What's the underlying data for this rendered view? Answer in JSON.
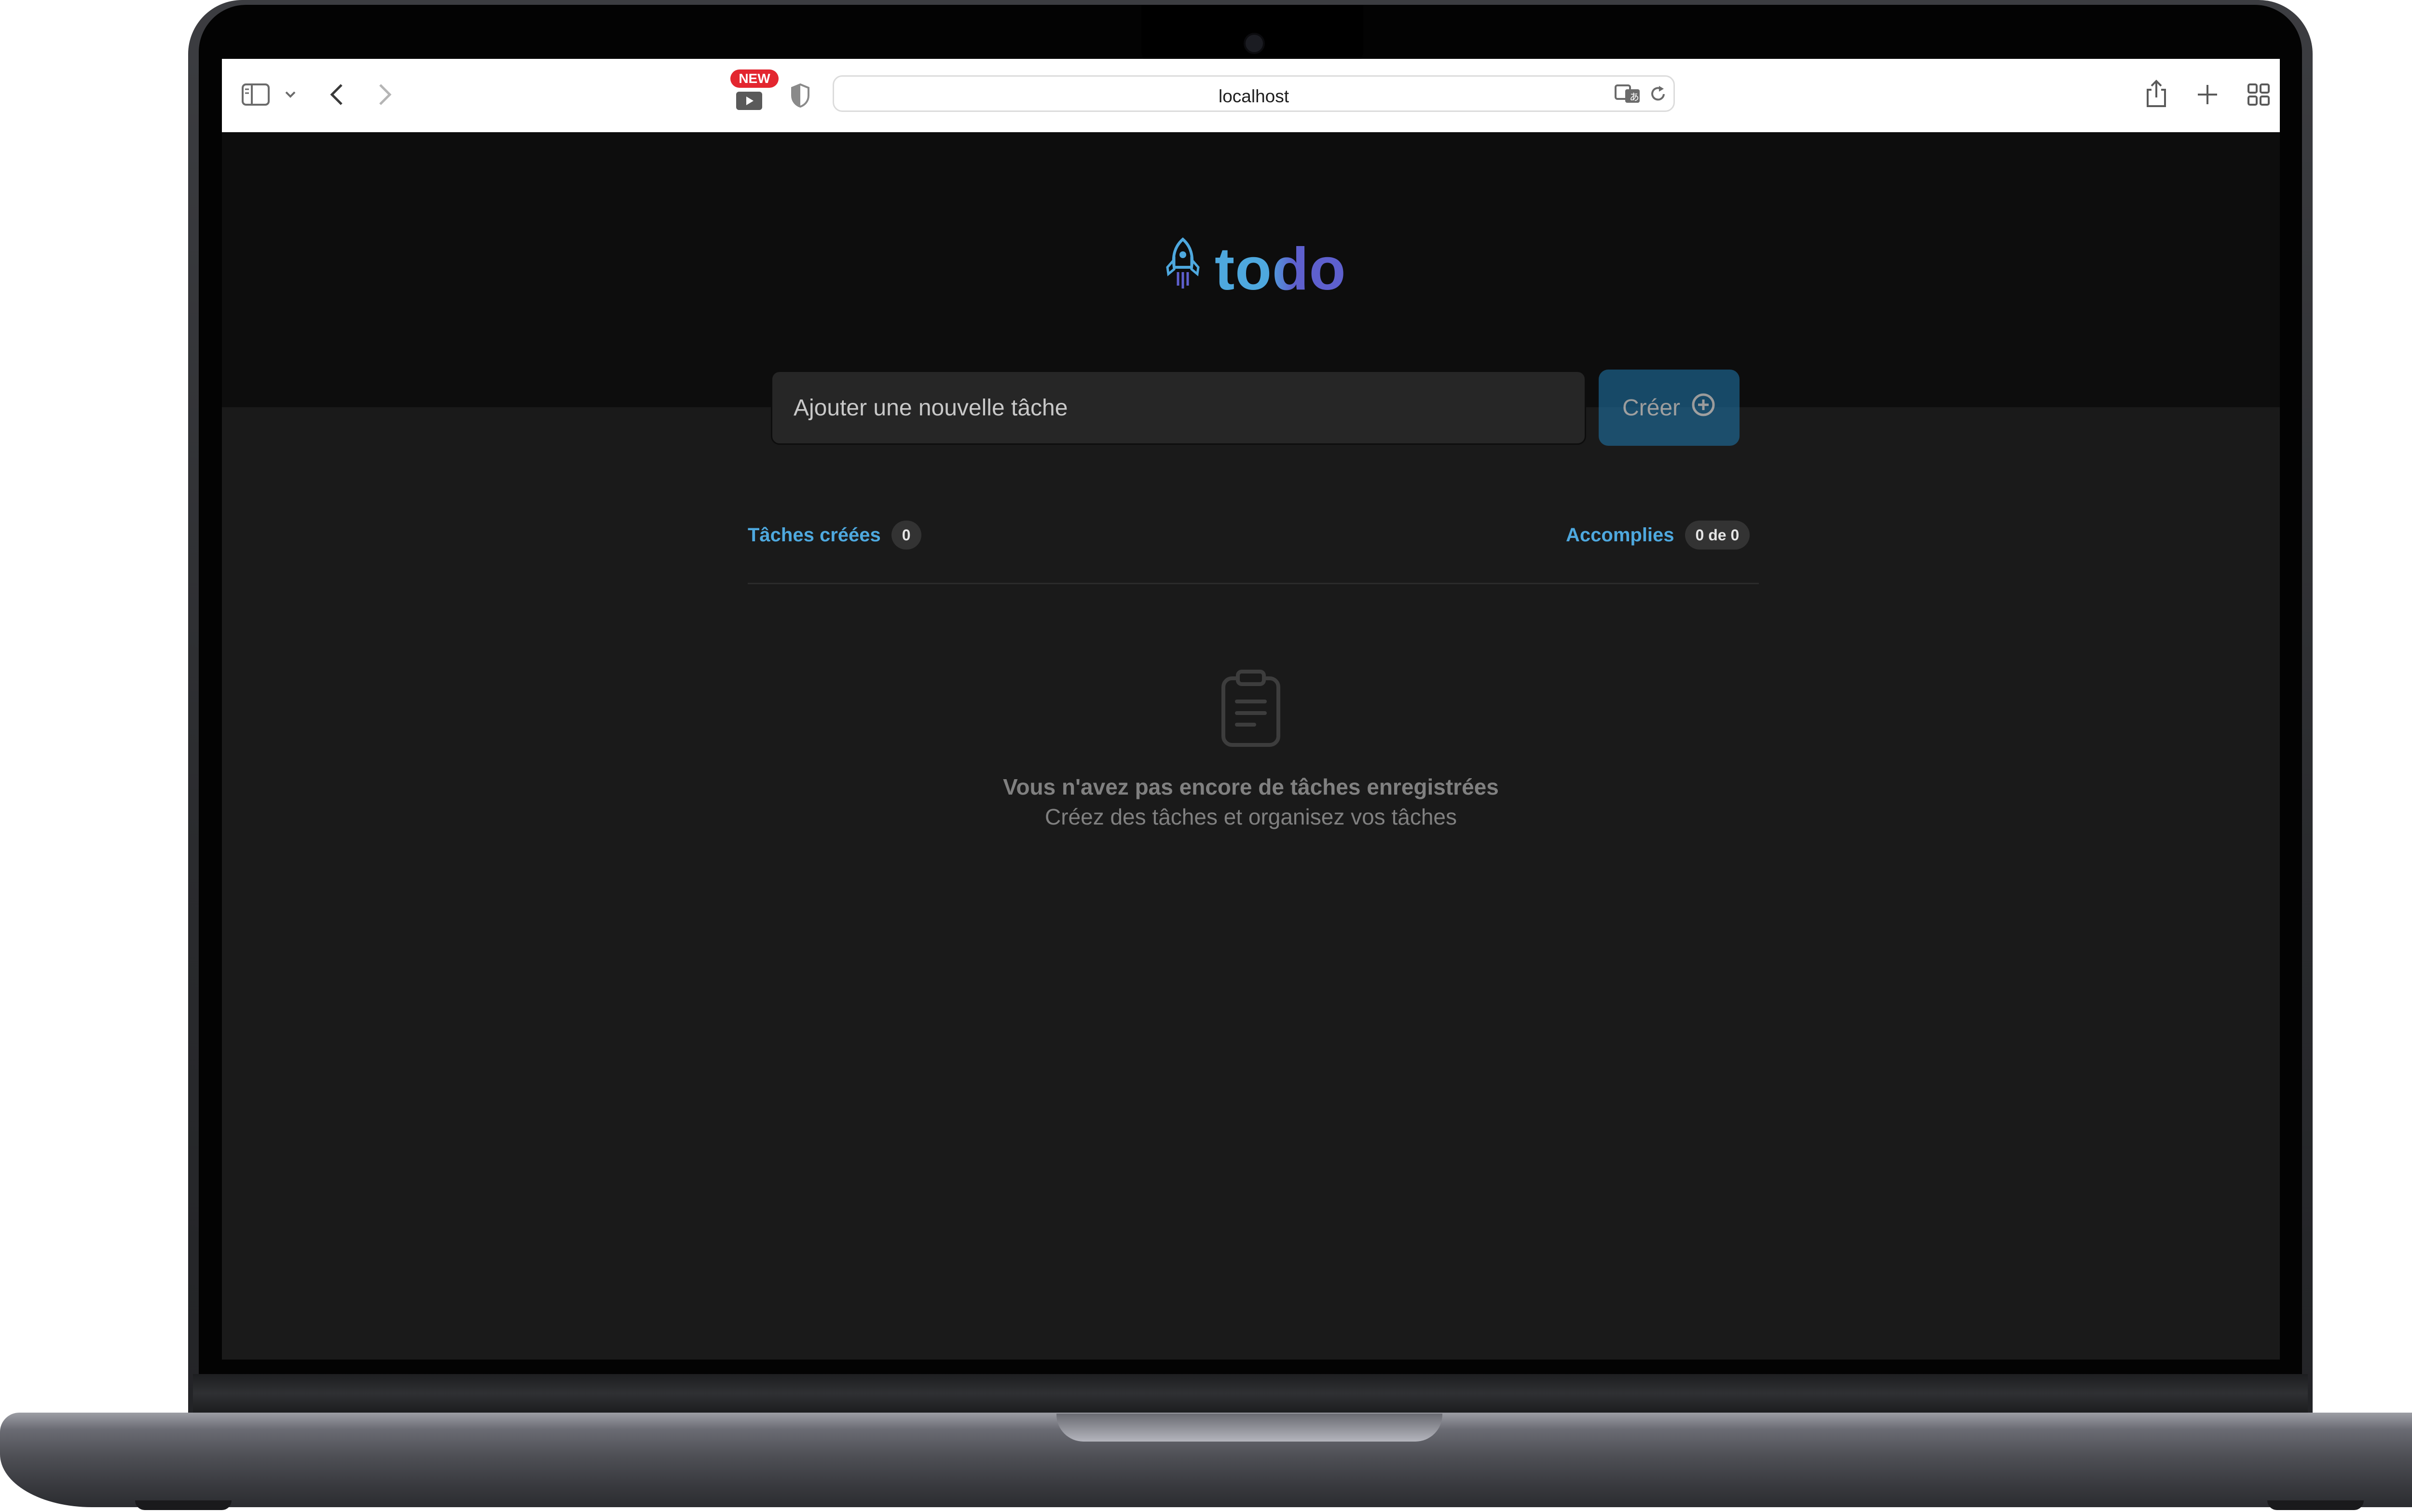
{
  "browser": {
    "url": "localhost",
    "new_badge": "NEW"
  },
  "app": {
    "logo_text": "todo",
    "input_placeholder": "Ajouter une nouvelle tâche",
    "create_label": "Créer",
    "created_label": "Tâches créées",
    "created_count": "0",
    "done_label": "Accomplies",
    "done_count": "0 de 0",
    "empty_title": "Vous n'avez pas encore de tâches enregistrées",
    "empty_subtitle": "Créez des tâches et organisez vos tâches"
  },
  "colors": {
    "blue": "#4ea8de",
    "purple": "#5e60ce",
    "button": "#1e6f9f",
    "background": "#1a1a1a",
    "header": "#0d0d0d"
  }
}
